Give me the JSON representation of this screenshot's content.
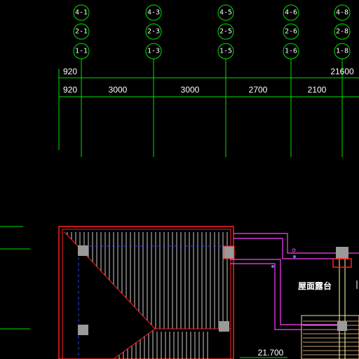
{
  "drawing": {
    "colors": {
      "background": "#000000",
      "axis_green": "#00e000",
      "roof_red": "#ff2020",
      "roof_hatch": "#ffffff",
      "dashed_blue": "#2a3cff",
      "pipe_magenta": "#ff40ff",
      "column_gray": "#9a9a9a",
      "hatch_right": "#ffd49a"
    },
    "axis_bubbles": {
      "columns": [
        {
          "labels": [
            "4-1",
            "2-1",
            "1-1"
          ]
        },
        {
          "labels": [
            "4-3",
            "2-3",
            "1-3"
          ]
        },
        {
          "labels": [
            "4-5",
            "2-5",
            "1-5"
          ]
        },
        {
          "labels": [
            "4-6",
            "2-6",
            "1-6"
          ]
        },
        {
          "labels": [
            "4-8",
            "2-8",
            "1-8"
          ]
        }
      ]
    },
    "dimensions": {
      "overall_left": "920",
      "overall_right": "21600",
      "segments": [
        "920",
        "3000",
        "3000",
        "2700",
        "2100"
      ]
    },
    "labels": {
      "roof_terrace": "屋面露台",
      "elevation": "21.700"
    }
  }
}
